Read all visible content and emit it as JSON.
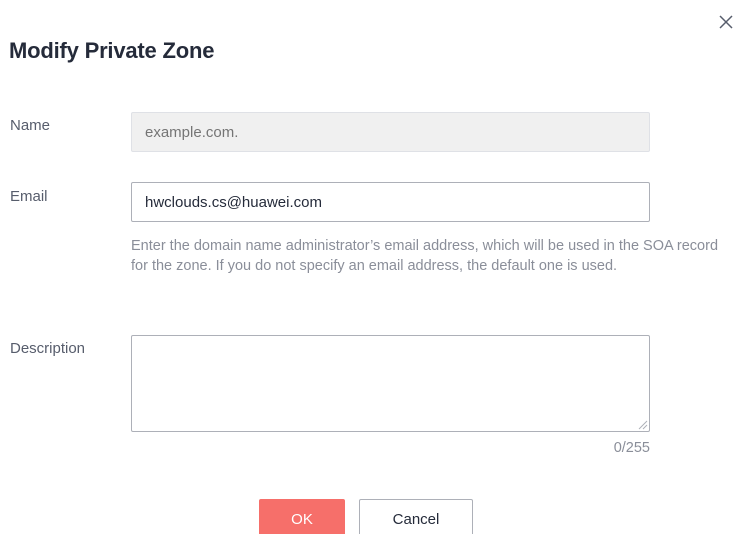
{
  "dialog": {
    "title": "Modify Private Zone",
    "close_icon": "close-icon"
  },
  "form": {
    "name": {
      "label": "Name",
      "placeholder": "example.com.",
      "disabled": true
    },
    "email": {
      "label": "Email",
      "value": "hwclouds.cs@huawei.com",
      "hint": "Enter the domain name administrator’s email address, which will be used in the SOA record for the zone. If you do not specify an email address, the default one is used."
    },
    "description": {
      "label": "Description",
      "value": "",
      "counter": "0/255"
    }
  },
  "actions": {
    "ok_label": "OK",
    "cancel_label": "Cancel"
  },
  "colors": {
    "primary": "#f66f6a",
    "text": "#252b3a",
    "label": "#575d6c",
    "hint": "#8a8e99",
    "border": "#adb0b8",
    "disabled_bg": "#f0f0f0"
  }
}
